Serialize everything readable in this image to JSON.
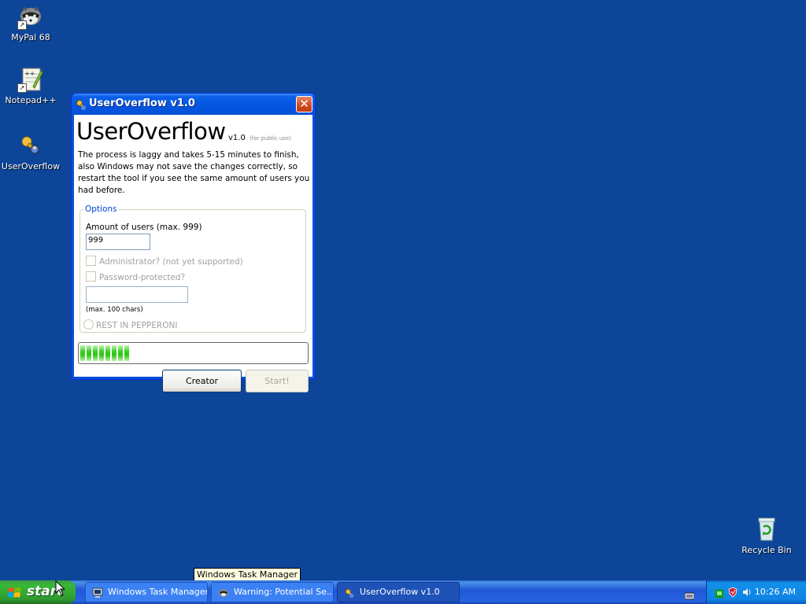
{
  "desktop": {
    "icons": [
      {
        "label": "MyPal 68"
      },
      {
        "label": "Notepad++"
      },
      {
        "label": "UserOverflow"
      },
      {
        "label": "Recycle Bin"
      }
    ]
  },
  "window": {
    "title": "UserOverflow v1.0",
    "close_glyph": "✕",
    "app_name": "UserOverflow",
    "version": "v1.0",
    "version_note": "(for public use)",
    "description": "The process is laggy and takes 5-15 minutes to finish, also Windows may not save the changes correctly, so restart the tool if you see the same amount of users you had before.",
    "options": {
      "legend": "Options",
      "amount_label": "Amount of users (max. 999)",
      "amount_value": "999",
      "admin_label": "Administrator? (not yet supported)",
      "password_label": "Password-protected?",
      "password_value": "",
      "max_chars_note": "(max. 100 chars)",
      "radio_label": "REST IN PEPPERONI"
    },
    "progress": {
      "fraction": 0.23
    },
    "buttons": {
      "creator": "Creator",
      "start": "Start!"
    }
  },
  "tooltip": "Windows Task Manager",
  "taskbar": {
    "start_label": "start",
    "tasks": [
      {
        "label": "Windows Task Manager",
        "icon": "task-manager-icon"
      },
      {
        "label": "Warning: Potential Se...",
        "icon": "warning-app-icon"
      },
      {
        "label": "UserOverflow v1.0",
        "icon": "useroverflow-icon"
      }
    ],
    "clock": "10:26 AM"
  },
  "colors": {
    "desktop": "#0d4599",
    "titlebar": "#0555e0",
    "progress": "#2cc414",
    "start": "#38b838"
  }
}
